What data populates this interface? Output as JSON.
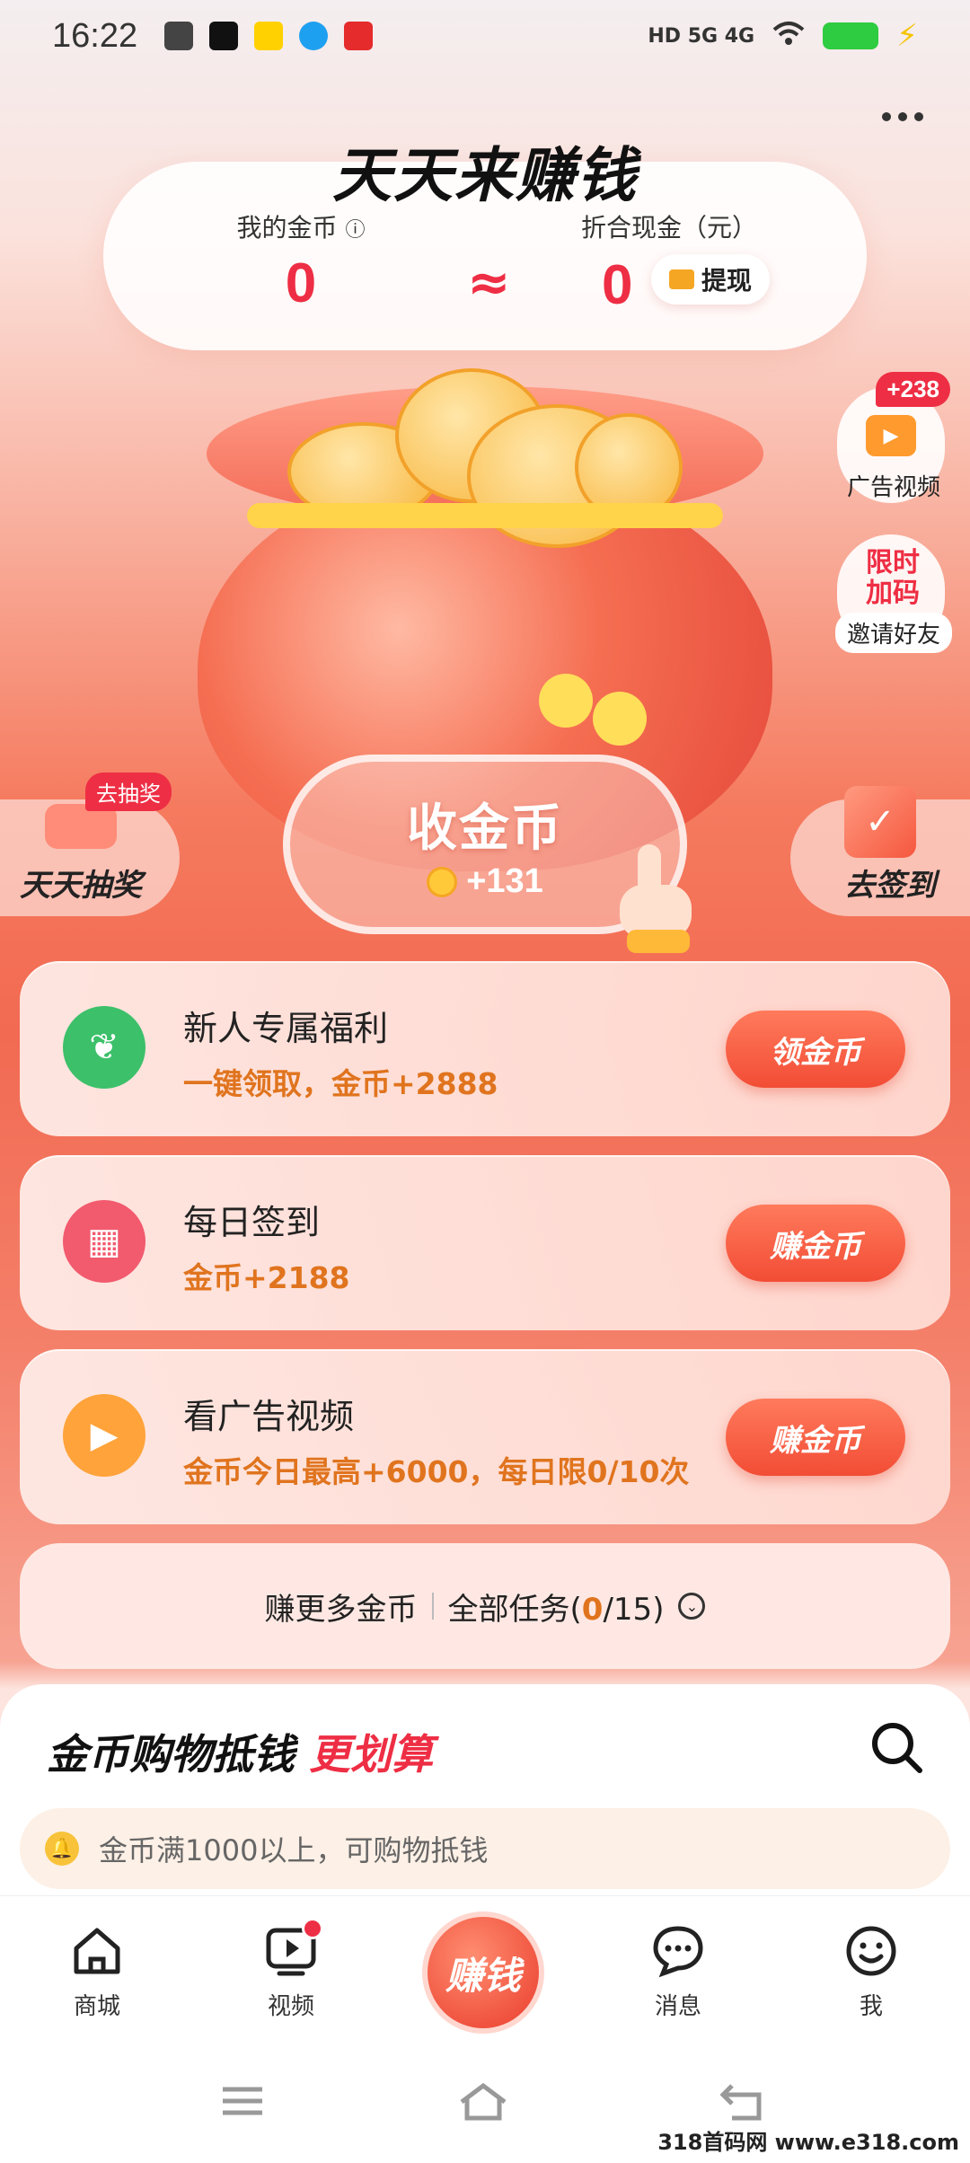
{
  "status": {
    "time": "16:22",
    "network": "HD 5G 4G"
  },
  "header": {
    "title": "天天来赚钱"
  },
  "coins": {
    "my_coins_label": "我的金币",
    "my_coins_value": "0",
    "approx": "≈",
    "cash_label": "折合现金（元）",
    "cash_value": "0",
    "withdraw_label": "提现"
  },
  "widgets": {
    "ad_badge": "+238",
    "ad_label": "广告视频",
    "invite_tag_line1": "限时",
    "invite_tag_line2": "加码",
    "invite_label": "邀请好友",
    "lottery_badge": "去抽奖",
    "lottery_label": "天天抽奖",
    "checkin_label": "去签到"
  },
  "collect": {
    "title": "收金币",
    "amount": "+131"
  },
  "tasks": [
    {
      "title": "新人专属福利",
      "subtitle": "一键领取，金币+2888",
      "button": "领金币",
      "icon": "sprout-icon",
      "color": "#3cc06a"
    },
    {
      "title": "每日签到",
      "subtitle": "金币+2188",
      "button": "赚金币",
      "icon": "calendar-icon",
      "color": "#f25a6e"
    },
    {
      "title": "看广告视频",
      "subtitle": "金币今日最高+6000，每日限0/10次",
      "button": "赚金币",
      "icon": "video-camera-icon",
      "color": "#ffa33a"
    }
  ],
  "more_tasks": {
    "earn_more": "赚更多金币",
    "all_tasks_prefix": "全部任务(",
    "done": "0",
    "total": "/15)"
  },
  "shop": {
    "title_main": "金币购物抵钱",
    "title_highlight": "更划算",
    "hint": "金币满1000以上，可购物抵钱"
  },
  "bottom_nav": {
    "items": [
      {
        "label": "商城",
        "icon": "home-icon"
      },
      {
        "label": "视频",
        "icon": "video-play-icon"
      },
      {
        "label": "赚钱",
        "icon": "earn-money-button"
      },
      {
        "label": "消息",
        "icon": "message-icon"
      },
      {
        "label": "我",
        "icon": "smile-icon"
      }
    ]
  },
  "watermark": "318首码网 www.e318.com",
  "colors": {
    "accent_red": "#ee2e44",
    "orange_text": "#e0741e",
    "button_red": "#f24d35"
  }
}
